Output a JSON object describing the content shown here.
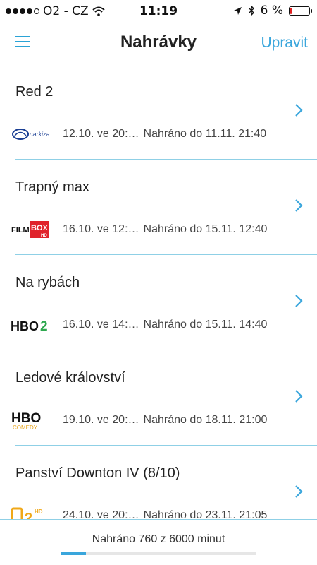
{
  "status_bar": {
    "signal_dots_filled": 4,
    "signal_dots_total": 5,
    "carrier": "O2 - CZ",
    "time": "11:19",
    "battery_text": "6 %",
    "battery_level": 0.06
  },
  "nav": {
    "title": "Nahrávky",
    "edit_label": "Upravit"
  },
  "recordings": [
    {
      "title": "Red 2",
      "channel": "markiza-logo",
      "aired": "12.10. ve 20:…",
      "recorded_until": "Nahráno do 11.11. 21:40"
    },
    {
      "title": "Trapný max",
      "channel": "filmbox-hd-logo",
      "aired": "16.10. ve 12:…",
      "recorded_until": "Nahráno do 15.11. 12:40"
    },
    {
      "title": "Na rybách",
      "channel": "hbo2-logo",
      "aired": "16.10. ve 14:…",
      "recorded_until": "Nahráno do 15.11. 14:40"
    },
    {
      "title": "Ledové království",
      "channel": "hbo-comedy-logo",
      "aired": "19.10. ve 20:…",
      "recorded_until": "Nahráno do 18.11. 21:00"
    },
    {
      "title": "Panství Downton IV (8/10)",
      "channel": "ct2-hd-logo",
      "aired": "24.10. ve 20:…",
      "recorded_until": "Nahráno do 23.11. 21:05"
    }
  ],
  "logo_text": {
    "markiza": "markiza",
    "filmbox_film": "FILM",
    "filmbox_box": "BOX",
    "filmbox_hd": "HD",
    "hbo2": "HBO",
    "hbo2_num": "2",
    "hbo_comedy": "HBO",
    "hbo_comedy_sub": "COMEDY",
    "ct2": "2",
    "ct2_hd": "HD"
  },
  "quota": {
    "text": "Nahráno 760 z 6000 minut",
    "used_minutes": 760,
    "total_minutes": 6000
  },
  "colors": {
    "accent": "#3aa6dc",
    "battery_low": "#e02020"
  }
}
